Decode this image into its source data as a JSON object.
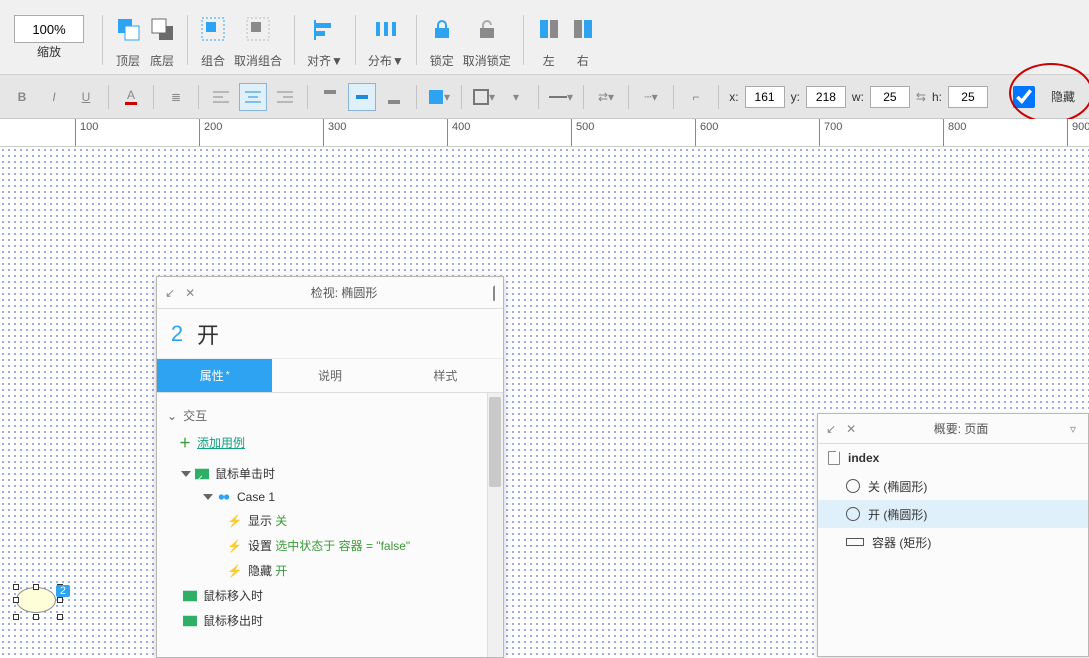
{
  "toolbar1": {
    "zoom": {
      "value": "100%",
      "label": "缩放"
    },
    "groups": {
      "front": "顶层",
      "back": "底层",
      "group": "组合",
      "ungroup": "取消组合",
      "align": "对齐▼",
      "distribute": "分布▼",
      "lock": "锁定",
      "unlock": "取消锁定",
      "left": "左",
      "right": "右"
    }
  },
  "toolbar2": {
    "x_label": "x:",
    "x": "161",
    "y_label": "y:",
    "y": "218",
    "w_label": "w:",
    "w": "25",
    "h_label": "h:",
    "h": "25",
    "hidden_label": "隐藏",
    "hidden_checked": true
  },
  "ruler": {
    "start": 100,
    "step": 100,
    "count": 10
  },
  "shape": {
    "badge": "2"
  },
  "inspector": {
    "title": "检视: 椭圆形",
    "index": "2",
    "name": "开",
    "tabs": {
      "prop": "属性",
      "note": "说明",
      "style": "样式"
    },
    "section": "交互",
    "add": "添加用例",
    "events": {
      "click": "鼠标单击时",
      "case": "Case 1",
      "a1_pre": "显示 ",
      "a1_kw": "关",
      "a2_pre": "设置 ",
      "a2_kw": "选中状态于 容器 = \"false\"",
      "a3_pre": "隐藏 ",
      "a3_kw": "开",
      "enter": "鼠标移入时",
      "leave": "鼠标移出时"
    }
  },
  "outline": {
    "title": "概要: 页面",
    "page": "index",
    "items": [
      {
        "label": "关 (椭圆形)",
        "sel": false,
        "shape": "circ"
      },
      {
        "label": "开 (椭圆形)",
        "sel": true,
        "shape": "circ"
      },
      {
        "label": "容器 (矩形)",
        "sel": false,
        "shape": "rect"
      }
    ]
  }
}
